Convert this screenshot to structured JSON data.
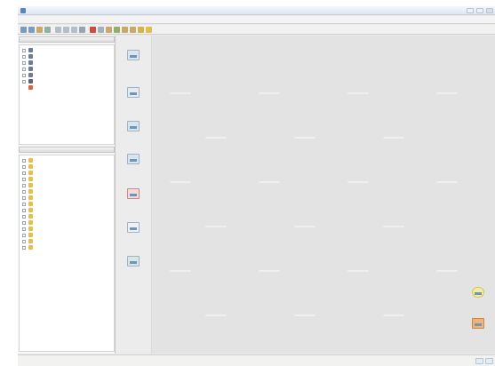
{
  "window": {
    "title": ""
  },
  "menubar": {
    "items": [
      "",
      "",
      "",
      "",
      "",
      "",
      "",
      "",
      ""
    ]
  },
  "toolbar": {
    "buttons": [
      "back-icon",
      "forward-icon",
      "stop-icon",
      "refresh-icon",
      "cut-icon",
      "copy-icon",
      "paste-icon",
      "delete-icon",
      "record-icon",
      "dot-icon",
      "find-icon",
      "open-icon",
      "save-icon",
      "print-icon",
      "help-icon",
      "star-icon"
    ]
  },
  "tree_top": {
    "header": "",
    "items": [
      {
        "label": "",
        "icon": "database-icon"
      },
      {
        "label": "",
        "icon": "database-icon"
      },
      {
        "label": "",
        "icon": "database-icon"
      },
      {
        "label": "",
        "icon": "database-icon"
      },
      {
        "label": "",
        "icon": "database-icon"
      },
      {
        "label": "",
        "icon": "user-icon"
      },
      {
        "label": "",
        "icon": "dashboard-icon"
      }
    ]
  },
  "tree_bottom": {
    "header": "",
    "items": [
      {
        "label": "",
        "selected": true
      },
      {
        "label": ""
      },
      {
        "label": ""
      },
      {
        "label": ""
      },
      {
        "label": ""
      },
      {
        "label": ""
      },
      {
        "label": ""
      },
      {
        "label": ""
      },
      {
        "label": ""
      },
      {
        "label": ""
      },
      {
        "label": ""
      },
      {
        "label": ""
      },
      {
        "label": ""
      },
      {
        "label": ""
      },
      {
        "label": ""
      }
    ]
  },
  "desktop": {
    "left_icons": [
      {
        "label": "",
        "icon": "folder-window-icon"
      },
      {
        "label": "",
        "icon": "document-window-icon"
      },
      {
        "label": "",
        "icon": "chart-window-icon"
      },
      {
        "label": "",
        "icon": "report-window-icon"
      },
      {
        "label": "",
        "icon": "red-document-icon"
      },
      {
        "label": "",
        "icon": "blank-window-icon"
      },
      {
        "label": "",
        "icon": "landscape-window-icon"
      }
    ],
    "right_icons": [
      {
        "label": "",
        "icon": "lightbulb-icon"
      },
      {
        "label": "",
        "icon": "orange-document-icon"
      }
    ],
    "watermark_text": ""
  },
  "statusbar": {
    "text": "",
    "buttons": [
      "status-left-icon",
      "status-right-icon"
    ]
  },
  "colors": {
    "accent": "#5b84b8",
    "pane_bg": "#f7f7f7",
    "desktop_bg": "#e3e3e4"
  }
}
